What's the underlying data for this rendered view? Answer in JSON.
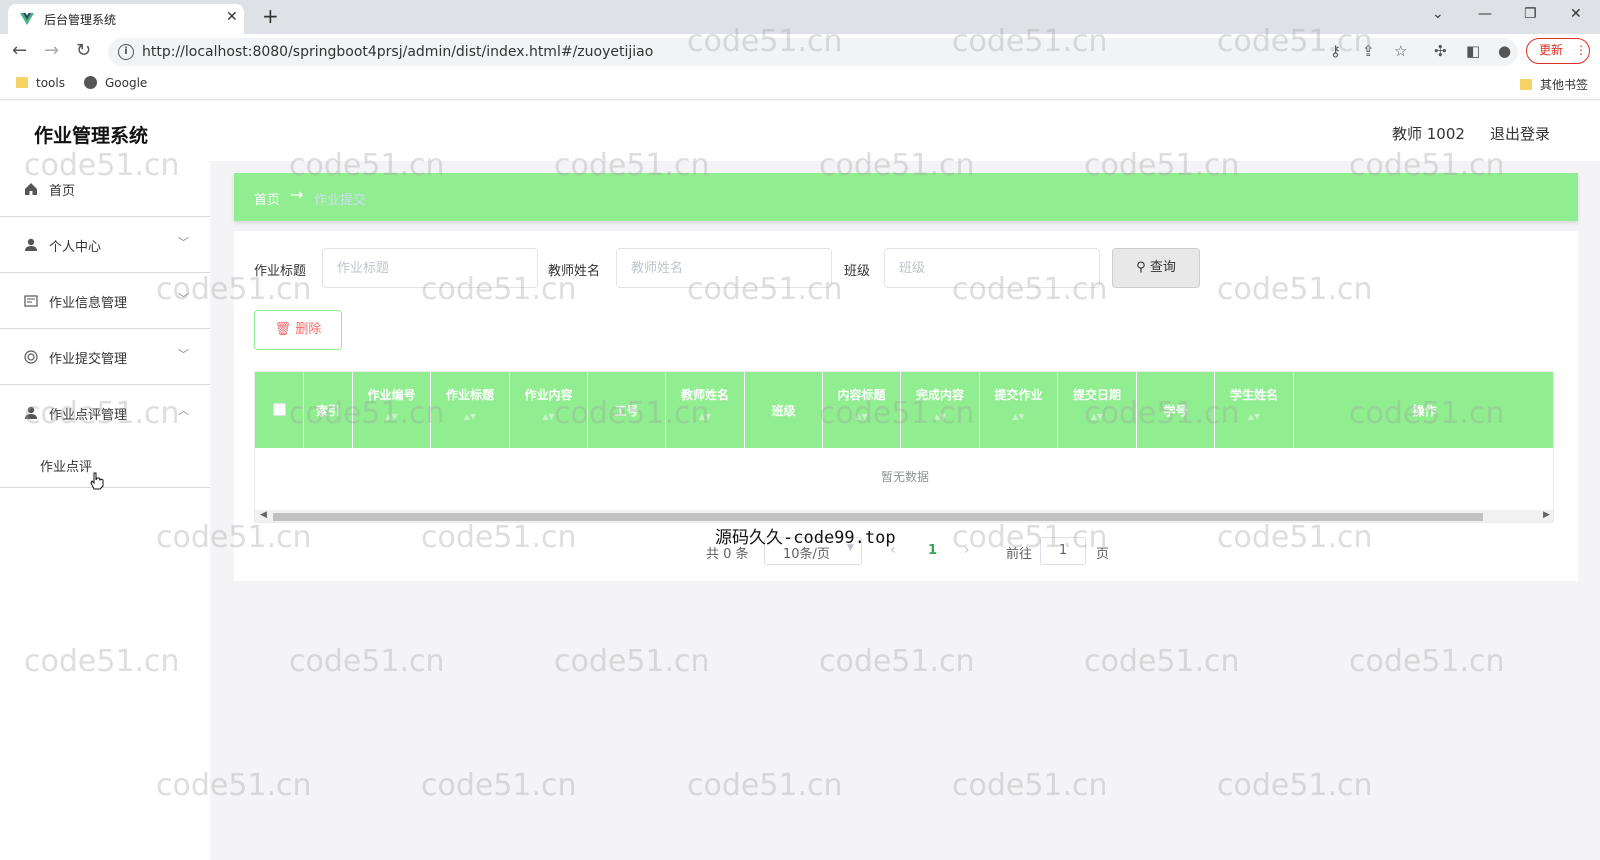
{
  "browser": {
    "tab_title": "后台管理系统",
    "tab_close": "✕",
    "new_tab": "+",
    "url": "http://localhost:8080/springboot4prsj/admin/dist/index.html#/zuoyetijiao",
    "update_label": "更新",
    "bookmarks": [
      "tools",
      "Google"
    ],
    "other_bookmarks": "其他书签"
  },
  "app": {
    "title": "作业管理系统",
    "user": "教师 1002",
    "logout": "退出登录"
  },
  "sidebar": {
    "items": [
      {
        "label": "首页",
        "icon": "home-icon"
      },
      {
        "label": "个人中心",
        "icon": "user-icon"
      },
      {
        "label": "作业信息管理",
        "icon": "form-icon"
      },
      {
        "label": "作业提交管理",
        "icon": "target-icon"
      },
      {
        "label": "作业点评管理",
        "icon": "user-icon"
      }
    ],
    "submenu": "作业点评",
    "arrow": "﹀"
  },
  "breadcrumb": {
    "home": "首页",
    "arrow": "→",
    "current": "作业提交"
  },
  "search": {
    "title_label": "作业标题",
    "title_placeholder": "作业标题",
    "teacher_label": "教师姓名",
    "teacher_placeholder": "教师姓名",
    "class_label": "班级",
    "class_placeholder": "班级",
    "button": "查询",
    "delete_button": "删除"
  },
  "table": {
    "headers": [
      "索引",
      "作业编号",
      "作业标题",
      "作业内容",
      "工号",
      "教师姓名",
      "班级",
      "内容标题",
      "完成内容",
      "提交作业",
      "提交日期",
      "学号",
      "学生姓名",
      "操作"
    ],
    "empty": "暂无数据"
  },
  "pagination": {
    "total": "共 0 条",
    "size": "10条/页",
    "current": "1",
    "goto": "前往",
    "goto_value": "1",
    "page_suffix": "页"
  },
  "overlay": "源码久久-code99.top",
  "watermark": "code51.cn",
  "colors": {
    "accent": "#90ee90",
    "delete": "#f56c6c",
    "page_active": "#2fa84f"
  }
}
